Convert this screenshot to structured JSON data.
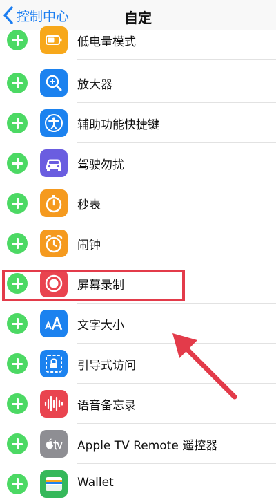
{
  "nav": {
    "back_label": "控制中心",
    "title": "自定"
  },
  "items": [
    {
      "label": "低电量模式",
      "icon": "battery-icon",
      "color": "#f7a81b"
    },
    {
      "label": "放大器",
      "icon": "magnifier-icon",
      "color": "#1c82ef"
    },
    {
      "label": "辅助功能快捷键",
      "icon": "accessibility-icon",
      "color": "#1c82ef"
    },
    {
      "label": "驾驶勿扰",
      "icon": "car-icon",
      "color": "#6a5de0"
    },
    {
      "label": "秒表",
      "icon": "stopwatch-icon",
      "color": "#f59a1f"
    },
    {
      "label": "闹钟",
      "icon": "alarm-clock-icon",
      "color": "#f59a1f"
    },
    {
      "label": "屏幕录制",
      "icon": "screen-record-icon",
      "color": "#e9444f"
    },
    {
      "label": "文字大小",
      "icon": "text-size-icon",
      "color": "#1c82ef"
    },
    {
      "label": "引导式访问",
      "icon": "guided-access-icon",
      "color": "#1c82ef"
    },
    {
      "label": "语音备忘录",
      "icon": "voice-memo-icon",
      "color": "#e9444f"
    },
    {
      "label": "Apple TV Remote 遥控器",
      "icon": "apple-tv-icon",
      "color": "#8e8e93"
    },
    {
      "label": "Wallet",
      "icon": "wallet-icon",
      "color": "#35b85a"
    }
  ],
  "colors": {
    "add_button": "#4cd964",
    "link_blue": "#1a7df1",
    "highlight": "#e33b4a"
  }
}
